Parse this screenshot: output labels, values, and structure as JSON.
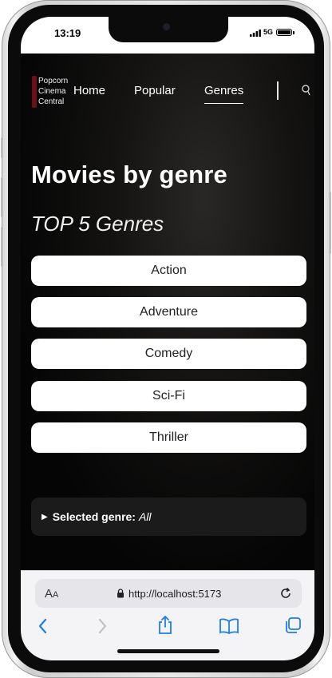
{
  "status_bar": {
    "time": "13:19",
    "network": "5G"
  },
  "site": {
    "logo_lines": [
      "Popcorn",
      "Cinema",
      "Central"
    ],
    "nav": {
      "home": "Home",
      "popular": "Popular",
      "genres": "Genres"
    },
    "active_nav": "Genres"
  },
  "page": {
    "title": "Movies by genre",
    "subtitle": "TOP 5 Genres",
    "genres": [
      "Action",
      "Adventure",
      "Comedy",
      "Sci-Fi",
      "Thriller"
    ],
    "selected": {
      "label": "Selected genre:",
      "value": "All"
    }
  },
  "browser": {
    "text_size_label_big": "A",
    "text_size_label_small": "A",
    "url": "http://localhost:5173"
  },
  "colors": {
    "logo_accent": "#6b0f1a",
    "ios_blue": "#1a7ef0",
    "button_bg": "#ffffff",
    "details_bg": "#1b1b1b"
  }
}
